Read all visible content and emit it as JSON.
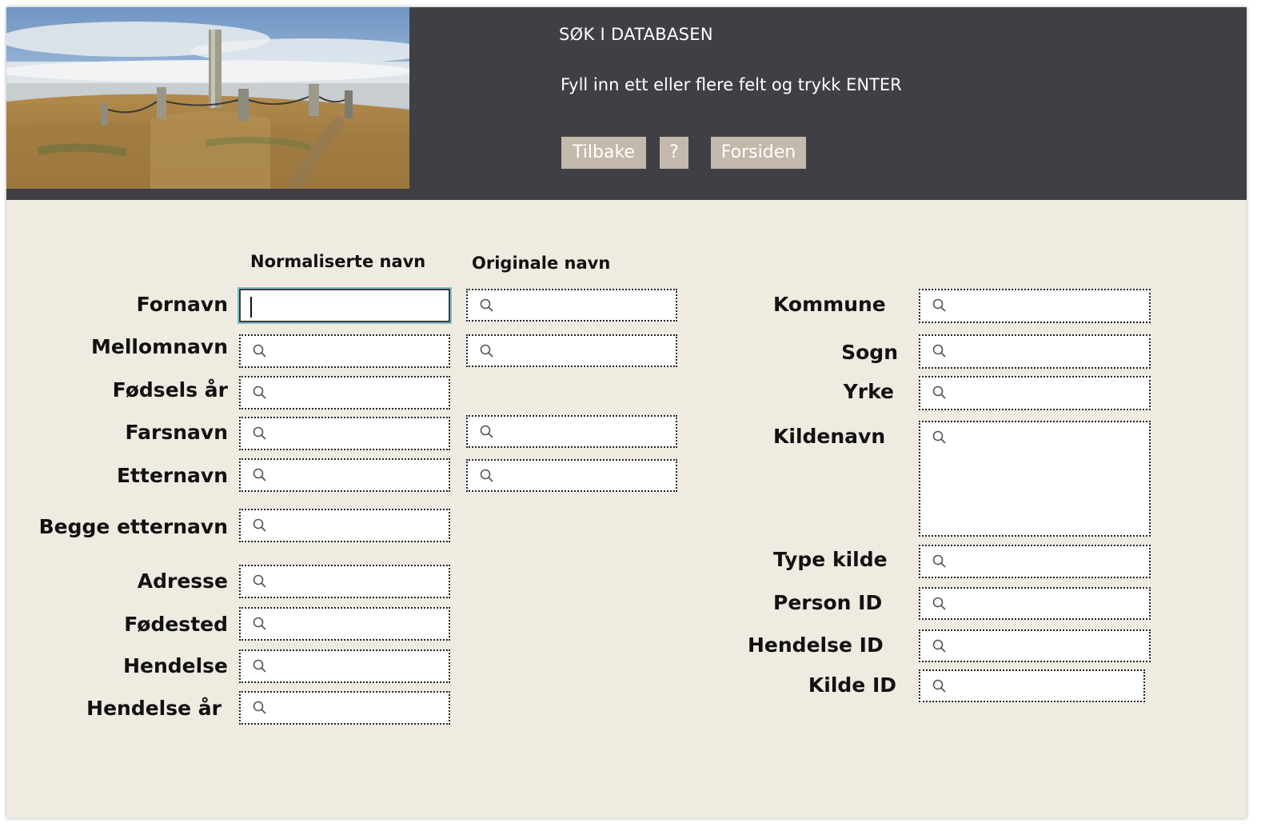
{
  "header": {
    "title": "SØK I DATABASEN",
    "instruction": "Fyll inn ett eller flere felt og trykk ENTER",
    "buttons": {
      "back": "Tilbake",
      "help": "?",
      "home": "Forsiden"
    }
  },
  "columns": {
    "normalized": "Normaliserte navn",
    "original": "Originale navn"
  },
  "left_fields": {
    "fornavn": {
      "label": "Fornavn",
      "value": ""
    },
    "mellomnavn": {
      "label": "Mellomnavn",
      "value": ""
    },
    "fodselsar": {
      "label": "Fødsels år",
      "value": ""
    },
    "farsnavn": {
      "label": "Farsnavn",
      "value": ""
    },
    "etternavn": {
      "label": "Etternavn",
      "value": ""
    },
    "begge_etternavn": {
      "label": "Begge etternavn",
      "value": ""
    },
    "adresse": {
      "label": "Adresse",
      "value": ""
    },
    "fodested": {
      "label": "Fødested",
      "value": ""
    },
    "hendelse": {
      "label": "Hendelse",
      "value": ""
    },
    "hendelse_ar": {
      "label": "Hendelse år",
      "value": ""
    }
  },
  "right_fields": {
    "kommune": {
      "label": "Kommune",
      "value": ""
    },
    "sogn": {
      "label": "Sogn",
      "value": ""
    },
    "yrke": {
      "label": "Yrke",
      "value": ""
    },
    "kildenavn": {
      "label": "Kildenavn",
      "value": ""
    },
    "type_kilde": {
      "label": "Type kilde",
      "value": ""
    },
    "person_id": {
      "label": "Person ID",
      "value": ""
    },
    "hendelse_id": {
      "label": "Hendelse ID",
      "value": ""
    },
    "kilde_id": {
      "label": "Kilde ID",
      "value": ""
    }
  },
  "icons": {
    "field_icon": "search-icon",
    "header_image": "standing-stones-photo"
  },
  "colors": {
    "header_bg": "#3f4045",
    "page_bg": "#efebe1",
    "button_bg": "#c3b9ac",
    "focus_ring": "#7fc0c8"
  }
}
